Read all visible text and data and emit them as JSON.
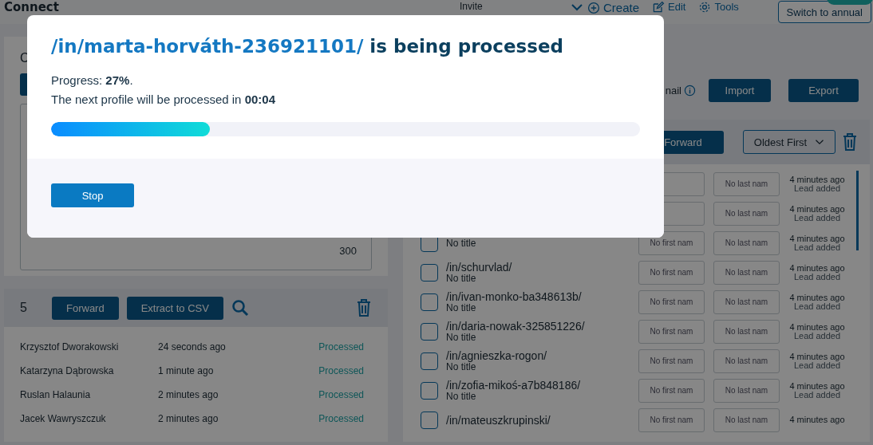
{
  "topbar": {
    "title": "Connect",
    "invite": "Invite",
    "actions": [
      {
        "label": "Create"
      },
      {
        "label": "Edit"
      },
      {
        "label": "Tools"
      }
    ],
    "upgrade": "Switch to annual"
  },
  "left": {
    "heading": "C",
    "counter": "300",
    "count": "5",
    "buttons": [
      "Forward",
      "Extract to CSV"
    ],
    "rows": [
      {
        "name": "Krzysztof Dworakowski",
        "time": "24 seconds ago",
        "status": "Processed"
      },
      {
        "name": "Katarzyna Dąbrowska",
        "time": "1 minute ago",
        "status": "Processed"
      },
      {
        "name": "Ruslan Halaunia",
        "time": "2 minutes ago",
        "status": "Processed"
      },
      {
        "name": "Jacek Wawryszczuk",
        "time": "2 minutes ago",
        "status": "Processed"
      }
    ]
  },
  "right": {
    "email_label": "nail",
    "buttons": [
      "Import",
      "Export"
    ],
    "forward": "Forward",
    "sort": "Oldest First",
    "rows": [
      {
        "last_name": "No last nam",
        "time": "4 minutes ago",
        "event": "Lead added"
      },
      {
        "last_name": "No last nam",
        "time": "4 minutes ago",
        "event": "Lead added"
      },
      {
        "checked": false,
        "title": "No title",
        "first_name": "No first nam",
        "last_name": "No last nam",
        "time": "4 minutes ago",
        "event": "Lead added"
      },
      {
        "checked": false,
        "profile": "/in/schurvlad/",
        "title": "No title",
        "first_name": "No first nam",
        "last_name": "No last nam",
        "time": "4 minutes ago",
        "event": "Lead added"
      },
      {
        "checked": false,
        "profile": "/in/ivan-monko-ba348613b/",
        "title": "No title",
        "first_name": "No first nam",
        "last_name": "No last nam",
        "time": "4 minutes ago",
        "event": "Lead added"
      },
      {
        "checked": false,
        "profile": "/in/daria-nowak-325851226/",
        "title": "No title",
        "first_name": "No first nam",
        "last_name": "No last nam",
        "time": "4 minutes ago",
        "event": "Lead added"
      },
      {
        "checked": false,
        "profile": "/in/agnieszka-rogon/",
        "title": "No title",
        "first_name": "No first nam",
        "last_name": "No last nam",
        "time": "4 minutes ago",
        "event": "Lead added"
      },
      {
        "checked": false,
        "profile": "/in/zofia-mikoś-a7b848186/",
        "title": "No title",
        "first_name": "No first nam",
        "last_name": "No last nam",
        "time": "4 minutes ago",
        "event": "Lead added"
      },
      {
        "checked": false,
        "profile": "/in/mateuszkrupinski/",
        "first_name": "No first nam",
        "last_name": "No last nam",
        "time": "4 minutes ago"
      }
    ]
  },
  "dialog": {
    "profile": "/in/marta-horváth-236921101/",
    "title_rest": " is being processed",
    "progress_text": "Progress: **27%**.",
    "next_text": "The next profile will be processed in **00:04**",
    "level": 0.27,
    "stop": "Stop"
  }
}
